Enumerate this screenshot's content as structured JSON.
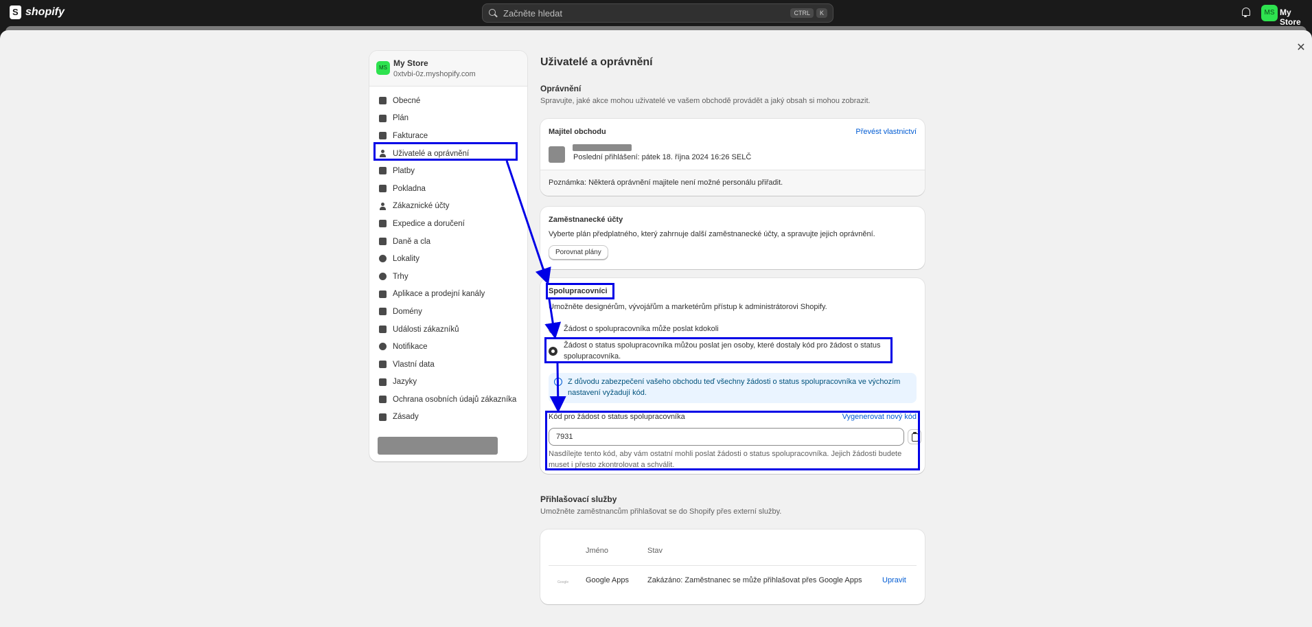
{
  "topbar": {
    "logo_text": "shopify",
    "search_placeholder": "Začněte hledat",
    "shortcut_1": "CTRL",
    "shortcut_2": "K",
    "avatar_initials": "MS",
    "store_name": "My Store"
  },
  "sidebar": {
    "avatar_initials": "MS",
    "store_name": "My Store",
    "store_domain": "0xtvbi-0z.myshopify.com",
    "items": [
      {
        "label": "Obecné",
        "icon": "store-icon"
      },
      {
        "label": "Plán",
        "icon": "plan-icon"
      },
      {
        "label": "Fakturace",
        "icon": "billing-icon"
      },
      {
        "label": "Uživatelé a oprávnění",
        "icon": "users-icon",
        "selected": true
      },
      {
        "label": "Platby",
        "icon": "payments-icon"
      },
      {
        "label": "Pokladna",
        "icon": "cart-icon"
      },
      {
        "label": "Zákaznické účty",
        "icon": "customer-icon"
      },
      {
        "label": "Expedice a doručení",
        "icon": "truck-icon"
      },
      {
        "label": "Daně a cla",
        "icon": "tax-icon"
      },
      {
        "label": "Lokality",
        "icon": "location-icon"
      },
      {
        "label": "Trhy",
        "icon": "globe-icon"
      },
      {
        "label": "Aplikace a prodejní kanály",
        "icon": "apps-icon"
      },
      {
        "label": "Domény",
        "icon": "domain-icon"
      },
      {
        "label": "Události zákazníků",
        "icon": "cursor-icon"
      },
      {
        "label": "Notifikace",
        "icon": "bell-icon"
      },
      {
        "label": "Vlastní data",
        "icon": "data-icon"
      },
      {
        "label": "Jazyky",
        "icon": "language-icon"
      },
      {
        "label": "Ochrana osobních údajů zákazníka",
        "icon": "lock-icon"
      },
      {
        "label": "Zásady",
        "icon": "policy-icon"
      }
    ]
  },
  "page": {
    "title": "Uživatelé a oprávnění",
    "permissions_title": "Oprávnění",
    "permissions_sub": "Spravujte, jaké akce mohou uživatelé ve vašem obchodě provádět a jaký obsah si mohou zobrazit."
  },
  "owner_card": {
    "title": "Majitel obchodu",
    "transfer_link": "Převést vlastnictví",
    "last_login": "Poslední přihlášení: pátek 18. října 2024 16:26 SELČ",
    "note": "Poznámka: Některá oprávnění majitele není možné personálu přiřadit."
  },
  "staff_card": {
    "title": "Zaměstnanecké účty",
    "desc": "Vyberte plán předplatného, který zahrnuje další zaměstnanecké účty, a spravujte jejich oprávnění.",
    "button": "Porovnat plány"
  },
  "collab_card": {
    "title": "Spolupracovníci",
    "desc": "Umožněte designérům, vývojářům a marketérům přístup k administrátorovi Shopify.",
    "option_anyone": "Žádost o spolupracovníka může poslat kdokoli",
    "option_code": "Žádost o status spolupracovníka můžou poslat jen osoby, které dostaly kód pro žádost o status spolupracovníka.",
    "banner": "Z důvodu zabezpečení vašeho obchodu teď všechny žádosti o status spolupracovníka ve výchozím nastavení vyžadují kód.",
    "code_label": "Kód pro žádost o status spolupracovníka",
    "regenerate_link": "Vygenerovat nový kód",
    "code_value": "7931",
    "hint": "Nasdílejte tento kód, aby vám ostatní mohli poslat žádosti o status spolupracovníka. Jejich žádosti budete muset i přesto zkontrolovat a schválit."
  },
  "login_services": {
    "title": "Přihlašovací služby",
    "sub": "Umožněte zaměstnancům přihlašovat se do Shopify přes externí služby.",
    "col_name": "Jméno",
    "col_status": "Stav",
    "row_name": "Google Apps",
    "row_status": "Zakázáno: Zaměstnanec se může přihlašovat přes Google Apps",
    "row_action": "Upravit",
    "row_icon_text": "Google"
  },
  "colors": {
    "topbar": "#1a1a1a",
    "background": "#f1f1f1",
    "link": "#005bd3",
    "annotation": "#0000e6",
    "avatar": "#2ee24f"
  }
}
